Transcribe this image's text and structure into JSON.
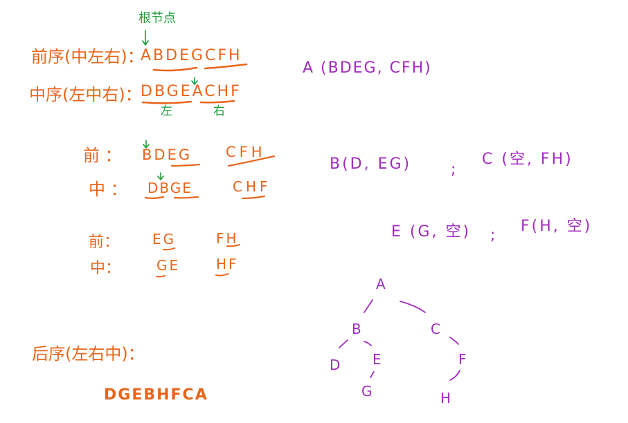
{
  "left": {
    "root_note": "根节点",
    "pre_label": "前序(中左右)：",
    "pre_seq": "ABDEGCFH",
    "in_label": "中序(左中右)：",
    "in_seq": "DBGEACHF",
    "in_left_tag": "左",
    "in_right_tag": "右",
    "step1_pre_label": "前 ：",
    "step1_pre_left": "BDEG",
    "step1_pre_right": "CFH",
    "step1_in_label": "中 ：",
    "step1_in_left": "DBGE",
    "step1_in_right": "CHF",
    "step2_pre_label": "前：",
    "step2_pre_left": "EG",
    "step2_pre_right": "FH",
    "step2_in_label": "中：",
    "step2_in_left": "GE",
    "step2_in_right": "HF",
    "post_label": "后序(左右中)：",
    "post_seq": "DGEBHFCA"
  },
  "right": {
    "line1": "A (BDEG, CFH)",
    "line2a": "B(D, EG)",
    "sep1": ";",
    "line2b": "C (空, FH)",
    "line3a": "E (G, 空)",
    "sep2": ";",
    "line3b": "F(H, 空)"
  },
  "tree": {
    "nodes": [
      "A",
      "B",
      "C",
      "D",
      "E",
      "F",
      "G",
      "H"
    ]
  },
  "colors": {
    "orange": "#e8651a",
    "green": "#1f9d3a",
    "purple": "#a12bbd"
  }
}
